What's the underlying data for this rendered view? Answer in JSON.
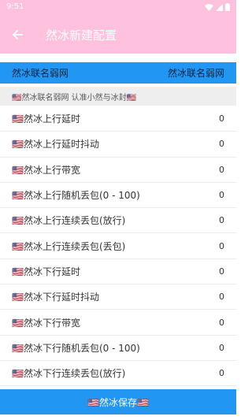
{
  "status_bar": {
    "time": "9:51"
  },
  "app_bar": {
    "title": "然冰新建配置"
  },
  "header": {
    "left": "然冰联名弱网",
    "right": "然冰联名弱网"
  },
  "hint": {
    "text": "🇺🇸然冰联名弱网 认准小然与冰封🇺🇸"
  },
  "items": [
    {
      "label": "🇺🇸然冰上行延时",
      "value": "0"
    },
    {
      "label": "🇺🇸然冰上行延时抖动",
      "value": "0"
    },
    {
      "label": "🇺🇸然冰上行带宽",
      "value": "0"
    },
    {
      "label": "🇺🇸然冰上行随机丢包(0 - 100)",
      "value": "0"
    },
    {
      "label": "🇺🇸然冰上行连续丢包(放行)",
      "value": "0"
    },
    {
      "label": "🇺🇸然冰上行连续丢包(丢包)",
      "value": "0"
    },
    {
      "label": "🇺🇸然冰下行延时",
      "value": "0"
    },
    {
      "label": "🇺🇸然冰下行延时抖动",
      "value": "0"
    },
    {
      "label": "🇺🇸然冰下行带宽",
      "value": "0"
    },
    {
      "label": "🇺🇸然冰下行随机丢包(0 - 100)",
      "value": "0"
    },
    {
      "label": "🇺🇸然冰下行连续丢包(放行)",
      "value": "0"
    }
  ],
  "save_button": {
    "label": "🇺🇸然冰保存🇺🇸"
  },
  "colors": {
    "app_bar": "#ffc1dd",
    "accent": "#2196f3"
  },
  "icons": [
    "back-arrow-icon",
    "wifi-icon",
    "signal-icon",
    "battery-icon"
  ]
}
